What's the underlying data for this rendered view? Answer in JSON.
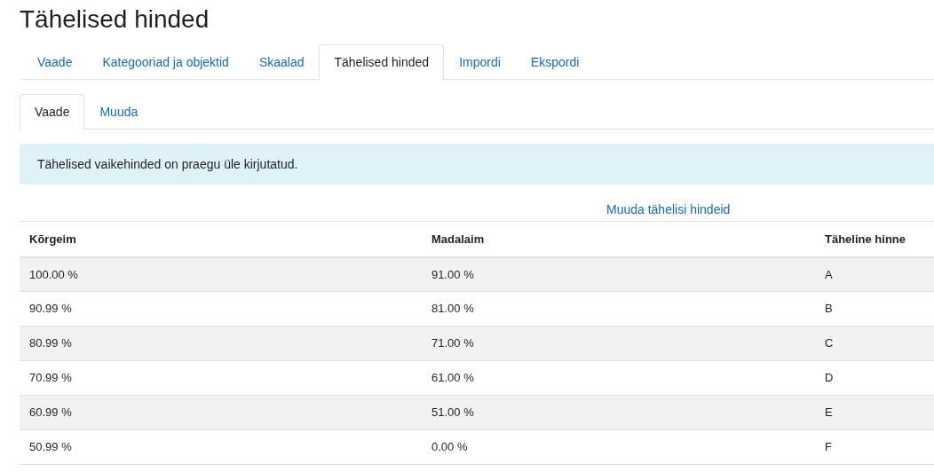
{
  "title": "Tähelised hinded",
  "tabs": [
    {
      "label": "Vaade",
      "selected": false
    },
    {
      "label": "Kategooriad ja objektid",
      "selected": false
    },
    {
      "label": "Skaalad",
      "selected": false
    },
    {
      "label": "Tähelised hinded",
      "selected": true
    },
    {
      "label": "Impordi",
      "selected": false
    },
    {
      "label": "Ekspordi",
      "selected": false
    }
  ],
  "subtabs": [
    {
      "label": "Vaade",
      "selected": true
    },
    {
      "label": "Muuda",
      "selected": false
    }
  ],
  "alert": "Tähelised vaikehinded on praegu üle kirjutatud.",
  "edit_link": "Muuda tähelisi hindeid",
  "table": {
    "columns": [
      "Kõrgeim",
      "Madalaim",
      "Täheline hinne"
    ],
    "rows": [
      [
        "100.00 %",
        "91.00 %",
        "A"
      ],
      [
        "90.99 %",
        "81.00 %",
        "B"
      ],
      [
        "80.99 %",
        "71.00 %",
        "C"
      ],
      [
        "70.99 %",
        "61.00 %",
        "D"
      ],
      [
        "60.99 %",
        "51.00 %",
        "E"
      ],
      [
        "50.99 %",
        "0.00 %",
        "F"
      ]
    ]
  }
}
